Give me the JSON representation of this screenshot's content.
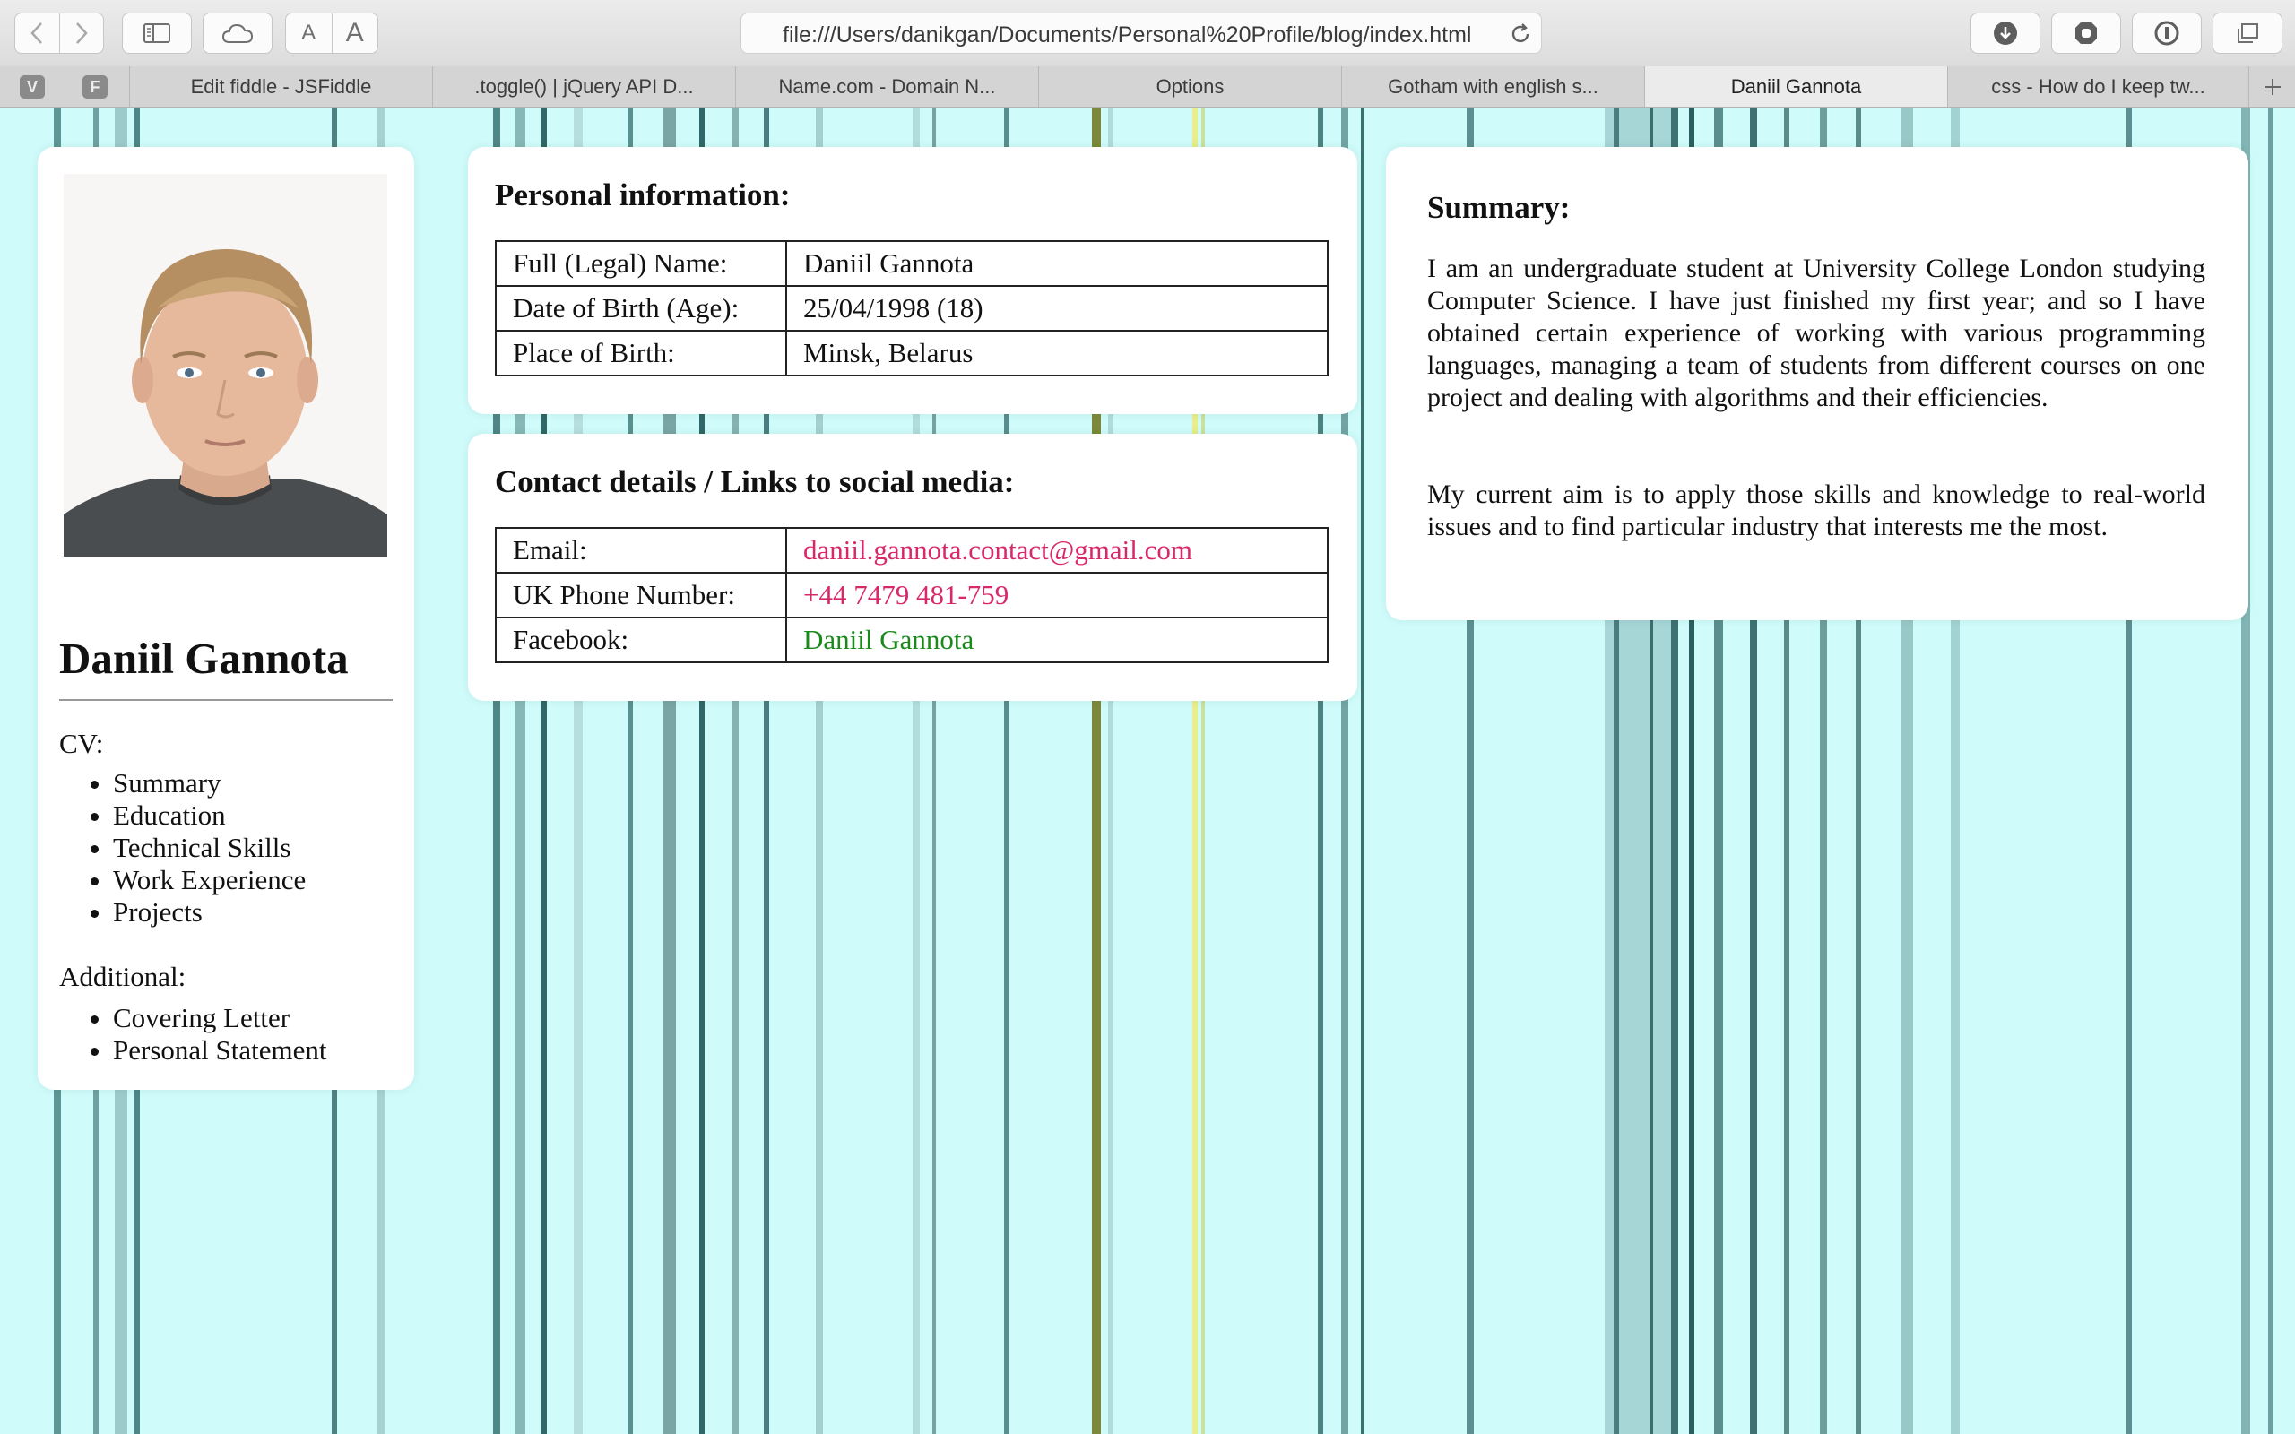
{
  "browser": {
    "url": "file:///Users/danikgan/Documents/Personal%20Profile/blog/index.html",
    "font_small": "A",
    "font_large": "A",
    "pinned_tabs": [
      "V",
      "F"
    ],
    "tabs": [
      {
        "label": "Edit fiddle - JSFiddle",
        "active": false
      },
      {
        "label": ".toggle() | jQuery API D...",
        "active": false
      },
      {
        "label": "Name.com - Domain N...",
        "active": false
      },
      {
        "label": "Options",
        "active": false
      },
      {
        "label": "Gotham with english s...",
        "active": false
      },
      {
        "label": "Daniil Gannota",
        "active": true
      },
      {
        "label": "css - How do I keep tw...",
        "active": false
      }
    ],
    "new_tab": "+"
  },
  "profile": {
    "name": "Daniil Gannota",
    "cv_label": "CV:",
    "cv_items": [
      "Summary",
      "Education",
      "Technical Skills",
      "Work Experience",
      "Projects"
    ],
    "additional_label": "Additional:",
    "additional_items": [
      "Covering Letter",
      "Personal Statement"
    ]
  },
  "personal": {
    "title": "Personal information:",
    "rows": [
      {
        "key": "Full (Legal) Name:",
        "value": "Daniil Gannota"
      },
      {
        "key": "Date of Birth (Age):",
        "value": "25/04/1998 (18)"
      },
      {
        "key": "Place of Birth:",
        "value": "Minsk, Belarus"
      }
    ]
  },
  "contact": {
    "title": "Contact details / Links to social media:",
    "rows": [
      {
        "key": "Email:",
        "value": "daniil.gannota.contact@gmail.com"
      },
      {
        "key": "UK Phone Number:",
        "value": "+44 7479 481-759"
      },
      {
        "key": "Facebook:",
        "value": "Daniil Gannota"
      }
    ]
  },
  "summary": {
    "title": "Summary:",
    "paragraphs": [
      "I am an undergraduate student at University College London studying Computer Science. I have just finished my first year; and so I have obtained certain experience of working with various programming languages, managing a team of students from different courses on one project and dealing with algorithms and their efficiencies.",
      "My current aim is to apply those skills and knowledge to real-world issues and to find particular industry that interests me the most."
    ]
  },
  "colors": {
    "page_background": "#cffcfb",
    "link_pink": "#d8286a",
    "link_green": "#1a8a1a"
  }
}
